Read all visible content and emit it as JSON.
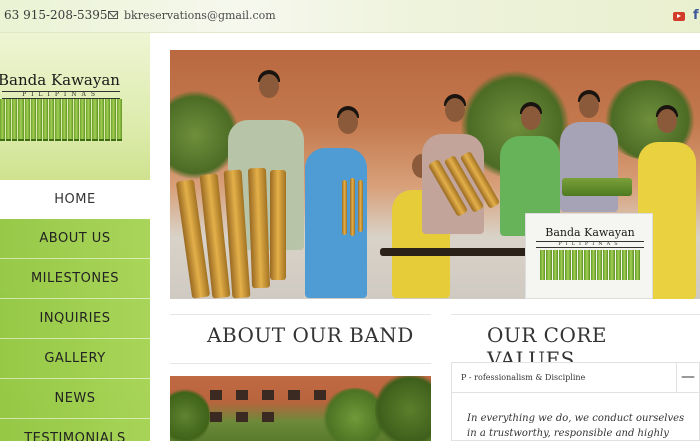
{
  "topbar": {
    "phone": "63 915-208-5395",
    "email": "bkreservations@gmail.com",
    "social": [
      {
        "icon": "youtube-icon"
      },
      {
        "icon": "facebook-icon",
        "glyph": "f"
      }
    ]
  },
  "logo": {
    "brand": "Banda Kawayan",
    "sub": "PILIPINAS"
  },
  "nav": {
    "items": [
      {
        "label": "HOME",
        "active": true
      },
      {
        "label": "ABOUT US"
      },
      {
        "label": "MILESTONES"
      },
      {
        "label": "INQUIRIES"
      },
      {
        "label": "GALLERY"
      },
      {
        "label": "NEWS"
      },
      {
        "label": "TESTIMONIALS"
      }
    ]
  },
  "hero": {
    "banner_brand": "Banda Kawayan",
    "banner_sub": "PILIPINAS"
  },
  "about": {
    "title": "ABOUT OUR BAND"
  },
  "values": {
    "title": "OUR CORE VALUES",
    "accordion": {
      "heading": "P - rofessionalism & Discipline",
      "toggle": "—",
      "body": "In everything we do, we conduct ourselves in a trustworthy, responsible and highly competent manner."
    }
  },
  "colors": {
    "accent_green": "#8ec43c",
    "youtube": "#d23b2a",
    "facebook": "#3b5998"
  }
}
